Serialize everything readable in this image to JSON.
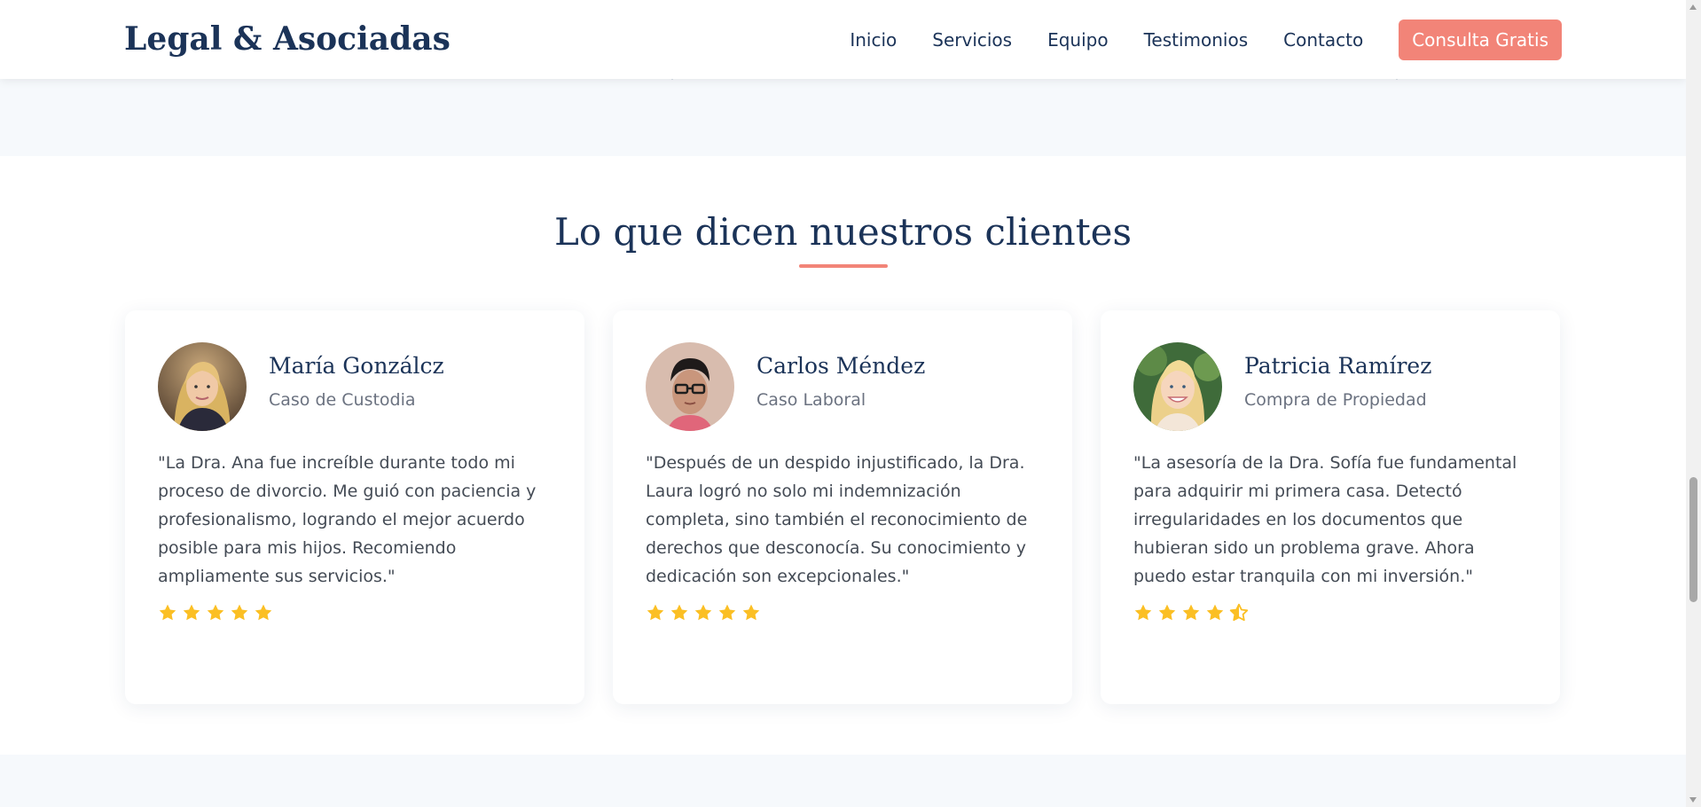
{
  "header": {
    "logo": "Legal & Asociadas",
    "nav": [
      "Inicio",
      "Servicios",
      "Equipo",
      "Testimonios",
      "Contacto"
    ],
    "cta": "Consulta Gratis"
  },
  "testimonials": {
    "title": "Lo que dicen nuestros clientes",
    "cards": [
      {
        "name": "María Gonzálcz",
        "case": "Caso de Custodia",
        "quote": "\"La Dra. Ana fue increíble durante todo mi proceso de divorcio. Me guió con paciencia y profesionalismo, logrando el mejor acuerdo posible para mis hijos. Recomiendo ampliamente sus servicios.\"",
        "rating": 5
      },
      {
        "name": "Carlos Méndez",
        "case": "Caso Laboral",
        "quote": "\"Después de un despido injustificado, la Dra. Laura logró no solo mi indemnización completa, sino también el reconocimiento de derechos que desconocía. Su conocimiento y dedicación son excepcionales.\"",
        "rating": 5
      },
      {
        "name": "Patricia Ramírez",
        "case": "Compra de Propiedad",
        "quote": "\"La asesoría de la Dra. Sofía fue fundamental para adquirir mi primera casa. Detectó irregularidades en los documentos que hubieran sido un problema grave. Ahora puedo estar tranquila con mi inversión.\"",
        "rating": 4.5
      }
    ]
  },
  "colors": {
    "navy": "#1b3358",
    "accent": "#f28478",
    "star": "#fbbf24",
    "section_bg": "#f6f9fc"
  },
  "icons": {
    "star_full": "star-icon",
    "star_half": "star-half-icon"
  }
}
